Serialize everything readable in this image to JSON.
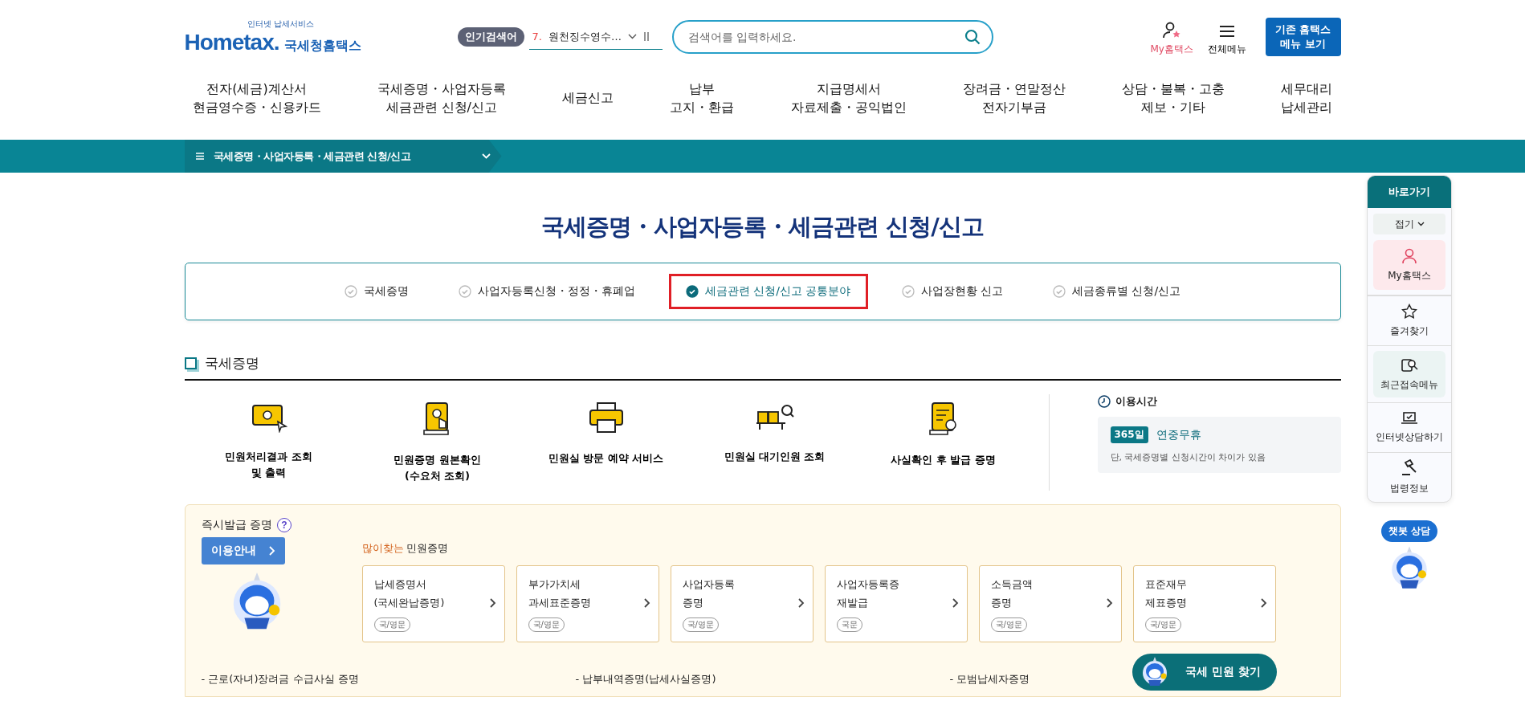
{
  "logo": {
    "tagline": "인터넷 납세서비스",
    "wordmark": "Hometax.",
    "name": "국세청홈택스"
  },
  "popular_search": {
    "badge": "인기검색어",
    "rank": "7.",
    "term": "원천징수영수…"
  },
  "search": {
    "placeholder": "검색어를 입력하세요."
  },
  "utility": [
    {
      "label": "My홈택스",
      "kind": "my"
    },
    {
      "label": "전체메뉴",
      "kind": "menu"
    }
  ],
  "legacy_button": {
    "lines": [
      "기존 홈택스",
      "메뉴 보기"
    ]
  },
  "nav": [
    {
      "lines": [
        "전자(세금)계산서",
        "현금영수증・신용카드"
      ]
    },
    {
      "lines": [
        "국세증명・사업자등록",
        "세금관련 신청/신고"
      ]
    },
    {
      "lines": [
        "세금신고"
      ]
    },
    {
      "lines": [
        "납부",
        "고지・환급"
      ]
    },
    {
      "lines": [
        "지급명세서",
        "자료제출・공익법인"
      ]
    },
    {
      "lines": [
        "장려금・연말정산",
        "전자기부금"
      ]
    },
    {
      "lines": [
        "상담・불복・고충",
        "제보・기타"
      ]
    },
    {
      "lines": [
        "세무대리",
        "납세관리"
      ]
    }
  ],
  "breadcrumb": {
    "label": "국세증명・사업자등록・세금관련 신청/신고"
  },
  "page_title": "국세증명・사업자등록・세금관련 신청/신고",
  "tabs": [
    {
      "label": "국세증명",
      "selected": false
    },
    {
      "label": "사업자등록신청・정정・휴폐업",
      "selected": false
    },
    {
      "label": "세금관련 신청/신고 공통분야",
      "selected": true
    },
    {
      "label": "사업장현황 신고",
      "selected": false
    },
    {
      "label": "세금종류별 신청/신고",
      "selected": false
    }
  ],
  "section": {
    "title": "국세증명",
    "services": [
      {
        "kind": "monitor",
        "lines": [
          "민원처리결과 조회",
          "및 출력"
        ]
      },
      {
        "kind": "scroll",
        "lines": [
          "민원증명 원본확인",
          "(수요처 조회)"
        ]
      },
      {
        "kind": "printer",
        "lines": [
          "민원실 방문 예약 서비스"
        ]
      },
      {
        "kind": "waiting",
        "lines": [
          "민원실 대기인원 조회"
        ]
      },
      {
        "kind": "certificate",
        "lines": [
          "사실확인 후 발급 증명"
        ]
      }
    ],
    "hours": {
      "title": "이용시간",
      "badge": "365일",
      "text": "연중무휴",
      "note": "단, 국세증명별 신청시간이 차이가 있음"
    }
  },
  "instant": {
    "title": "즉시발급 증명",
    "help": "?",
    "guide_button": "이용안내",
    "popular_accent": "많이찾는",
    "popular_rest": "민원증명",
    "cards": [
      {
        "lines": [
          "납세증명서",
          "(국세완납증명)"
        ],
        "tag": "국/영문"
      },
      {
        "lines": [
          "부가가치세",
          "과세표준증명"
        ],
        "tag": "국/영문"
      },
      {
        "lines": [
          "사업자등록",
          "증명"
        ],
        "tag": "국/영문"
      },
      {
        "lines": [
          "사업자등록증",
          "재발급"
        ],
        "tag": "국문"
      },
      {
        "lines": [
          "소득금액",
          "증명"
        ],
        "tag": "국/영문"
      },
      {
        "lines": [
          "표준재무",
          "제표증명"
        ],
        "tag": "국/영문"
      }
    ],
    "links": [
      "- 근로(자녀)장려금 수급사실 증명",
      "- 납부내역증명(납세사실증명)",
      "- 모범납세자증명"
    ]
  },
  "quick_menu": {
    "title": "바로가기",
    "collapse": "접기",
    "items": [
      {
        "label": "My홈택스",
        "kind": "my"
      },
      {
        "label": "즐겨찾기",
        "kind": "star"
      },
      {
        "label": "최근접속메뉴",
        "kind": "recent"
      },
      {
        "label": "인터넷상담하기",
        "kind": "laptop"
      },
      {
        "label": "법령정보",
        "kind": "gavel"
      }
    ]
  },
  "chatbot": {
    "label": "챗봇 상담"
  },
  "find_button": "국세 민원 찾기"
}
